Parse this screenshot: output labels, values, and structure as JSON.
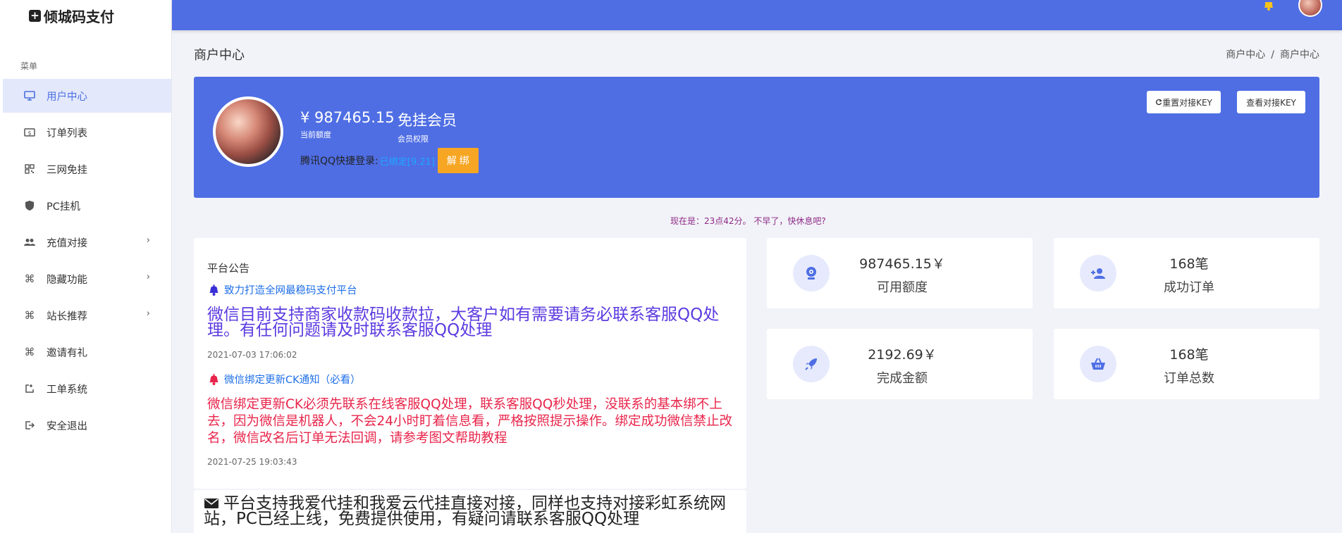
{
  "brand": {
    "name": "倾城码支付",
    "icon": "plus-square-icon"
  },
  "sidebar": {
    "caption": "菜单",
    "items": [
      {
        "label": "用户中心",
        "icon": "monitor-icon",
        "active": true
      },
      {
        "label": "订单列表",
        "icon": "dollar-bill-icon"
      },
      {
        "label": "三网免挂",
        "icon": "qrcode-icon"
      },
      {
        "label": "PC挂机",
        "icon": "shield-icon"
      },
      {
        "label": "充值对接",
        "icon": "users-icon",
        "chevron": true
      },
      {
        "label": "隐藏功能",
        "icon": "command-icon",
        "chevron": true
      },
      {
        "label": "站长推荐",
        "icon": "command-icon",
        "chevron": true
      },
      {
        "label": "邀请有礼",
        "icon": "command-icon"
      },
      {
        "label": "工单系统",
        "icon": "external-square-icon"
      },
      {
        "label": "安全退出",
        "icon": "logout-icon"
      }
    ]
  },
  "header": {
    "title": "商户中心",
    "breadcrumb": [
      "商户中心",
      "/",
      "商户中心"
    ]
  },
  "profile": {
    "balance": "¥ 987465.15",
    "balance_label": "当前额度",
    "member": "免挂会员",
    "member_label": "会员权限",
    "qq_label": "腾讯QQ快捷登录:",
    "qq_status": "已绑定[9.21]",
    "unbind_label": "解 绑",
    "reset_key_label": "重置对接KEY",
    "view_key_label": "查看对接KEY"
  },
  "time_notice": "现在是：23点42分。 不早了，快休息吧?",
  "announcement": {
    "title": "平台公告",
    "item1_title": "致力打造全网最稳码支付平台",
    "item1_body": "微信目前支持商家收款码收款拉，大客户如有需要请务必联系客服QQ处理。有任何问题请及时联系客服QQ处理",
    "item1_date": "2021-07-03 17:06:02",
    "item2_title": "微信绑定更新CK通知（必看）",
    "item2_body": "微信绑定更新CK必须先联系在线客服QQ处理，联系客服QQ秒处理，没联系的基本绑不上去，因为微信是机器人，不会24小时盯着信息看，严格按照提示操作。绑定成功微信禁止改名，微信改名后订单无法回调，请参考图文帮助教程",
    "item2_date": "2021-07-25 19:03:43",
    "item3_body": "平台支持我爱代挂和我爱云代挂直接对接，同样也支持对接彩虹系统网站，PC已经上线，免费提供使用，有疑问请联系客服QQ处理"
  },
  "stats": [
    {
      "value": "987465.15￥",
      "label": "可用额度",
      "icon": "webcam-icon"
    },
    {
      "value": "168笔",
      "label": "成功订单",
      "icon": "user-plus-icon"
    },
    {
      "value": "2192.69￥",
      "label": "完成金额",
      "icon": "rocket-icon"
    },
    {
      "value": "168笔",
      "label": "订单总数",
      "icon": "basket-icon"
    }
  ],
  "colors": {
    "primary": "#4f6ee4",
    "warning": "#f7a623",
    "link_blue": "#1e6fe8",
    "announce_purple": "#5b3ae0",
    "announce_red": "#e8254b",
    "time_notice": "#8d2a87"
  }
}
